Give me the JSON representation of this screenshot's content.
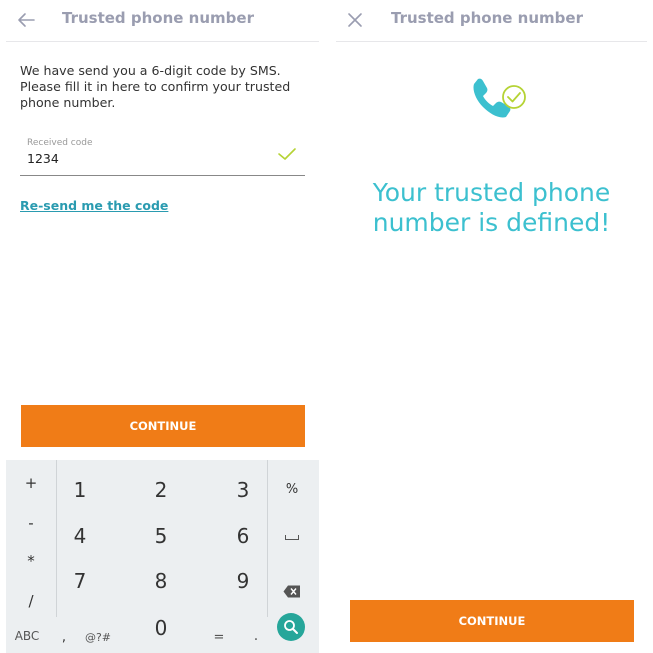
{
  "left": {
    "title": "Trusted phone number",
    "back_icon": "arrow-left-icon",
    "instructions": "We have send you a 6-digit code by SMS. Please fill it in here to confirm your trusted phone number.",
    "field": {
      "label": "Received code",
      "value": "1234",
      "valid_icon": "checkmark-icon"
    },
    "resend_link": "Re-send me the code",
    "continue_label": "CONTINUE"
  },
  "keyboard": {
    "sym_plus": "+",
    "sym_minus": "-",
    "sym_star": "*",
    "sym_slash": "/",
    "k1": "1",
    "k2": "2",
    "k3": "3",
    "k4": "4",
    "k5": "5",
    "k6": "6",
    "k7": "7",
    "k8": "8",
    "k9": "9",
    "k0": "0",
    "percent": "%",
    "abc": "ABC",
    "comma": ",",
    "symbols": "@?#",
    "equals": "=",
    "period": ".",
    "space_icon": "space-icon",
    "backspace_icon": "backspace-icon",
    "search_icon": "search-icon"
  },
  "right": {
    "title": "Trusted phone number",
    "close_icon": "close-icon",
    "illustration_icon": "phone-check-icon",
    "success_message": "Your trusted phone number is defined!",
    "continue_label": "CONTINUE"
  },
  "colors": {
    "accent_orange": "#f07c17",
    "teal": "#3cc0cf",
    "check_green": "#b5d334",
    "link": "#2a9bb0",
    "title_grey": "#9a9db0"
  }
}
